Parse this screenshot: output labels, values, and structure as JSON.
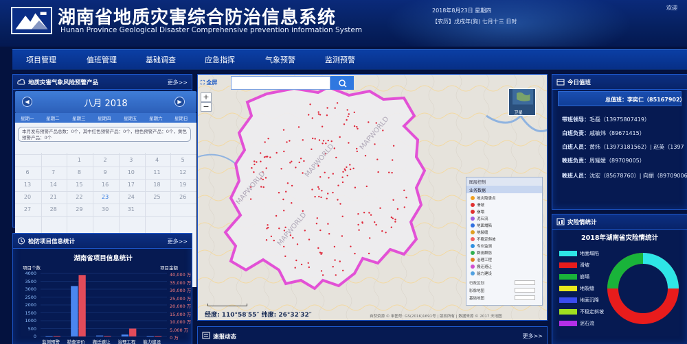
{
  "header": {
    "title_cn": "湖南省地质灾害综合防治信息系统",
    "title_en": "Hunan Province Geological Disaster Comprehensive prevention information System",
    "date_line": "2018年8月23日 星期四",
    "lunar_line": "【农历】戊戌年(狗) 七月十三 日时",
    "welcome": "欢迎"
  },
  "nav": {
    "items": [
      "项目管理",
      "值班管理",
      "基础调查",
      "应急指挥",
      "气象预警",
      "监测预警"
    ]
  },
  "warning_panel": {
    "title": "地质灾害气象风险预警产品",
    "more": "更多>>",
    "calendar": {
      "month": "八月",
      "year": "2018",
      "weekdays": [
        "星期一",
        "星期二",
        "星期三",
        "星期四",
        "星期五",
        "星期六",
        "星期日"
      ],
      "note": "本月发布预警产品总数：0个，其中红色预警产品：0个，橙色预警产品：0个，黄色预警产品：0个",
      "days": [
        [
          "",
          "",
          "1",
          "2",
          "3",
          "4",
          "5"
        ],
        [
          "6",
          "7",
          "8",
          "9",
          "10",
          "11",
          "12"
        ],
        [
          "13",
          "14",
          "15",
          "16",
          "17",
          "18",
          "19"
        ],
        [
          "20",
          "21",
          "22",
          "23",
          "24",
          "25",
          "26"
        ],
        [
          "27",
          "28",
          "29",
          "30",
          "31",
          "",
          ""
        ]
      ],
      "today": "23"
    }
  },
  "project_panel": {
    "title": "检防项目信息统计",
    "more": "更多>>",
    "chart_title": "湖南省项目信息统计",
    "left_axis_title": "项目个数",
    "right_axis_title": "项目金额",
    "colors": {
      "count": "#4a86f0",
      "amount": "#e24b5a"
    }
  },
  "chart_data": {
    "type": "bar",
    "title": "湖南省项目信息统计",
    "categories": [
      "监测预警",
      "勘查评价",
      "搬迁避让",
      "治理工程",
      "能力建设"
    ],
    "series": [
      {
        "name": "项目个数",
        "axis": "left",
        "values": [
          20,
          3200,
          60,
          120,
          20
        ]
      },
      {
        "name": "项目金额",
        "axis": "right",
        "values": [
          300,
          39000,
          400,
          5000,
          200
        ]
      }
    ],
    "left_ticks": [
      "4000",
      "3500",
      "3000",
      "2500",
      "2000",
      "1500",
      "1000",
      "500",
      "0"
    ],
    "right_ticks": [
      "40,000 万",
      "35,000 万",
      "30,000 万",
      "25,000 万",
      "20,000 万",
      "15,000 万",
      "10,000 万",
      "5,000 万",
      "0 万"
    ],
    "ylim_left": [
      0,
      4000
    ],
    "ylim_right": [
      0,
      40000
    ],
    "grid": true
  },
  "map": {
    "fullscreen": "全屏",
    "search_placeholder": "",
    "satellite_label": "卫星",
    "coords": "经度:  110°58′55″    纬度:  26°32′32″",
    "copyright": "自然资源 © 审图号: GS(2016)1691号  | 版权所有 | 数据来源 © 2017 天地图",
    "layers": {
      "head": "图层控制",
      "sub": "业务数据",
      "items": [
        "地灾隐患点",
        "滑坡",
        "崩塌",
        "泥石流",
        "地面塌陷",
        "地裂缝",
        "不稳定斜坡",
        "专业监测",
        "群测群防",
        "治理工程",
        "搬迁避让",
        "能力建设"
      ],
      "foot": [
        "行政区划",
        "影像地图",
        "基础地图"
      ]
    }
  },
  "duty_panel": {
    "title": "今日值班",
    "chief": "总值班：李奕仁（85167902）",
    "rows": [
      {
        "label": "带班领导：",
        "value": "毛磊（13975807419）"
      },
      {
        "label": "白班负责：",
        "value": "戚敏炜（89671415）"
      },
      {
        "label": "白班人员：",
        "value": "黄炜（13973181562）| 赵英（1397"
      },
      {
        "label": "晚班负责：",
        "value": "周耀媛（89709005）"
      },
      {
        "label": "晚班人员：",
        "value": "沈宏（85678760）| 向丽（89709006"
      }
    ]
  },
  "disaster_panel": {
    "title": "灾险情统计",
    "chart_title": "2018年湖南省灾险情统计",
    "legend": [
      {
        "label": "地面塌陷",
        "color": "#2ee6e6"
      },
      {
        "label": "滑坡",
        "color": "#e81c1c"
      },
      {
        "label": "崩塌",
        "color": "#19b43a"
      },
      {
        "label": "地裂缝",
        "color": "#e8e81c"
      },
      {
        "label": "地面沉降",
        "color": "#3a4cf0"
      },
      {
        "label": "不稳定斜坡",
        "color": "#a0e020"
      },
      {
        "label": "泥石流",
        "color": "#b42fe8"
      }
    ]
  },
  "sos_panel": {
    "title": "速报动态",
    "more": "更多>>"
  }
}
